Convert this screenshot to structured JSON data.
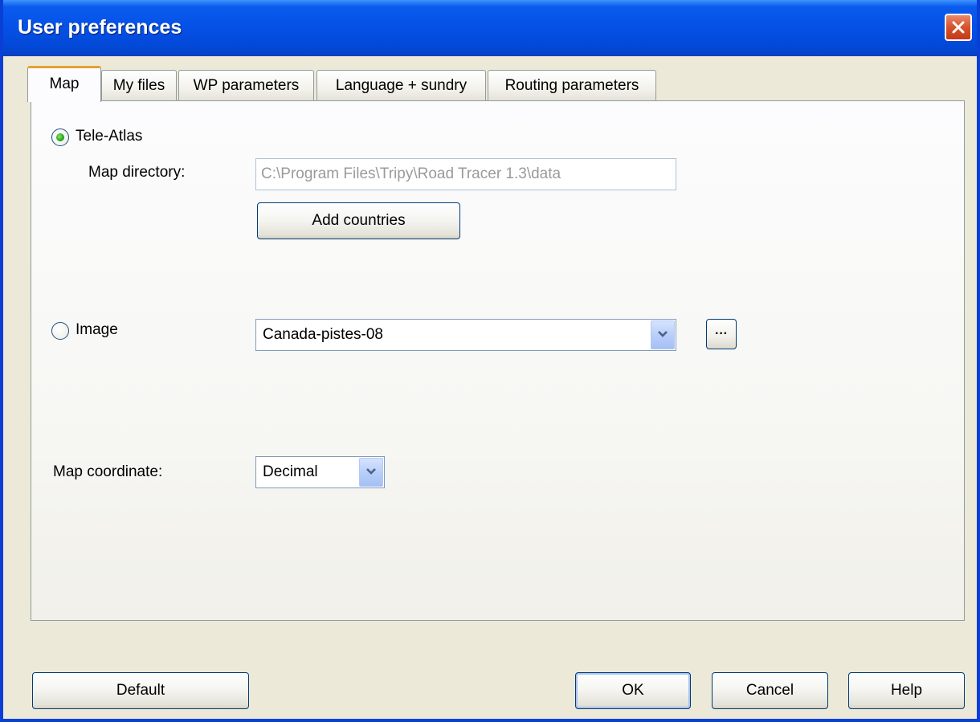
{
  "window": {
    "title": "User preferences",
    "close_icon": "close-icon"
  },
  "tabs": [
    {
      "label": "Map",
      "active": true
    },
    {
      "label": "My files",
      "active": false
    },
    {
      "label": "WP parameters",
      "active": false
    },
    {
      "label": "Language + sundry",
      "active": false
    },
    {
      "label": "Routing parameters",
      "active": false
    }
  ],
  "map_tab": {
    "tele_atlas": {
      "label": "Tele-Atlas",
      "selected": true,
      "map_directory_label": "Map directory:",
      "map_directory_value": "C:\\Program Files\\Tripy\\Road Tracer 1.3\\data",
      "add_countries_label": "Add countries"
    },
    "image": {
      "label": "Image",
      "selected": false,
      "selected_image": "Canada-pistes-08",
      "browse_label": "···"
    },
    "map_coordinate": {
      "label": "Map coordinate:",
      "value": "Decimal"
    }
  },
  "footer": {
    "default_label": "Default",
    "ok_label": "OK",
    "cancel_label": "Cancel",
    "help_label": "Help"
  },
  "colors": {
    "titlebar": "#0550e6",
    "window_bg": "#ece9d8",
    "close_button": "#d8512c",
    "active_tab_accent": "#e6a032",
    "radio_selected": "#23a41a"
  }
}
